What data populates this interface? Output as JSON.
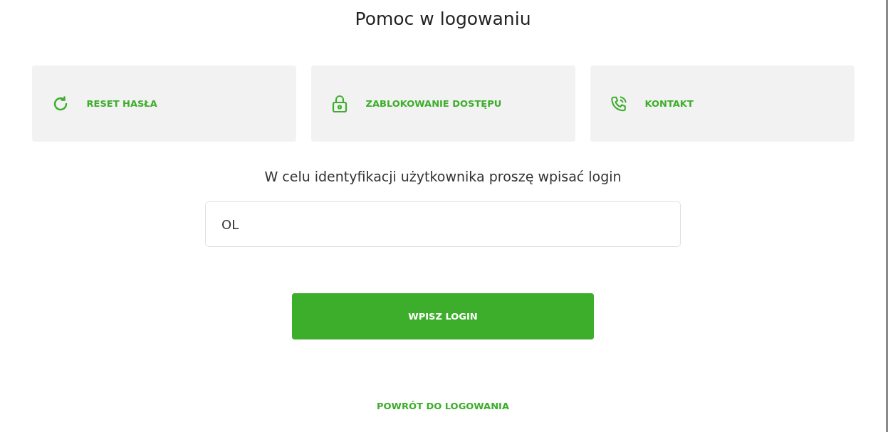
{
  "title": "Pomoc w logowaniu",
  "options": [
    {
      "kind": "refresh",
      "label": "RESET HASŁA"
    },
    {
      "kind": "lock",
      "label": "ZABLOKOWANIE DOSTĘPU"
    },
    {
      "kind": "phone",
      "label": "KONTAKT"
    }
  ],
  "instruction": "W celu identyfikacji użytkownika proszę wpisać login",
  "login_field": {
    "value": "OL"
  },
  "submit_button": "WPISZ LOGIN",
  "back_link": "POWRÓT DO LOGOWANIA"
}
